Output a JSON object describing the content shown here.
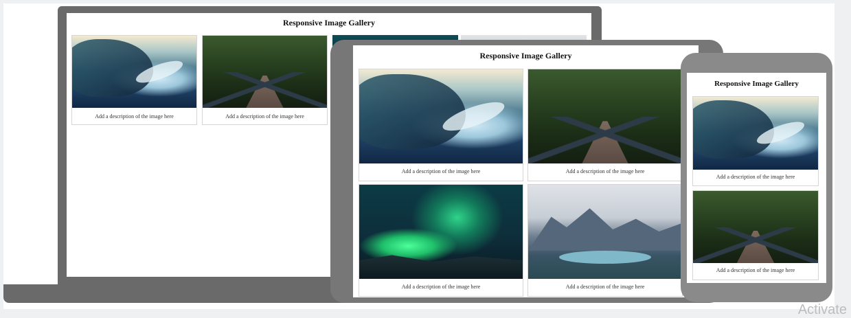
{
  "gallery_title": "Responsive Image Gallery",
  "image_description": "Add a description of the image here",
  "watermark_text": "Activate",
  "images": [
    {
      "subject": "lake-landscape"
    },
    {
      "subject": "forest-bridge"
    },
    {
      "subject": "aurora"
    },
    {
      "subject": "mountain-lake"
    }
  ]
}
